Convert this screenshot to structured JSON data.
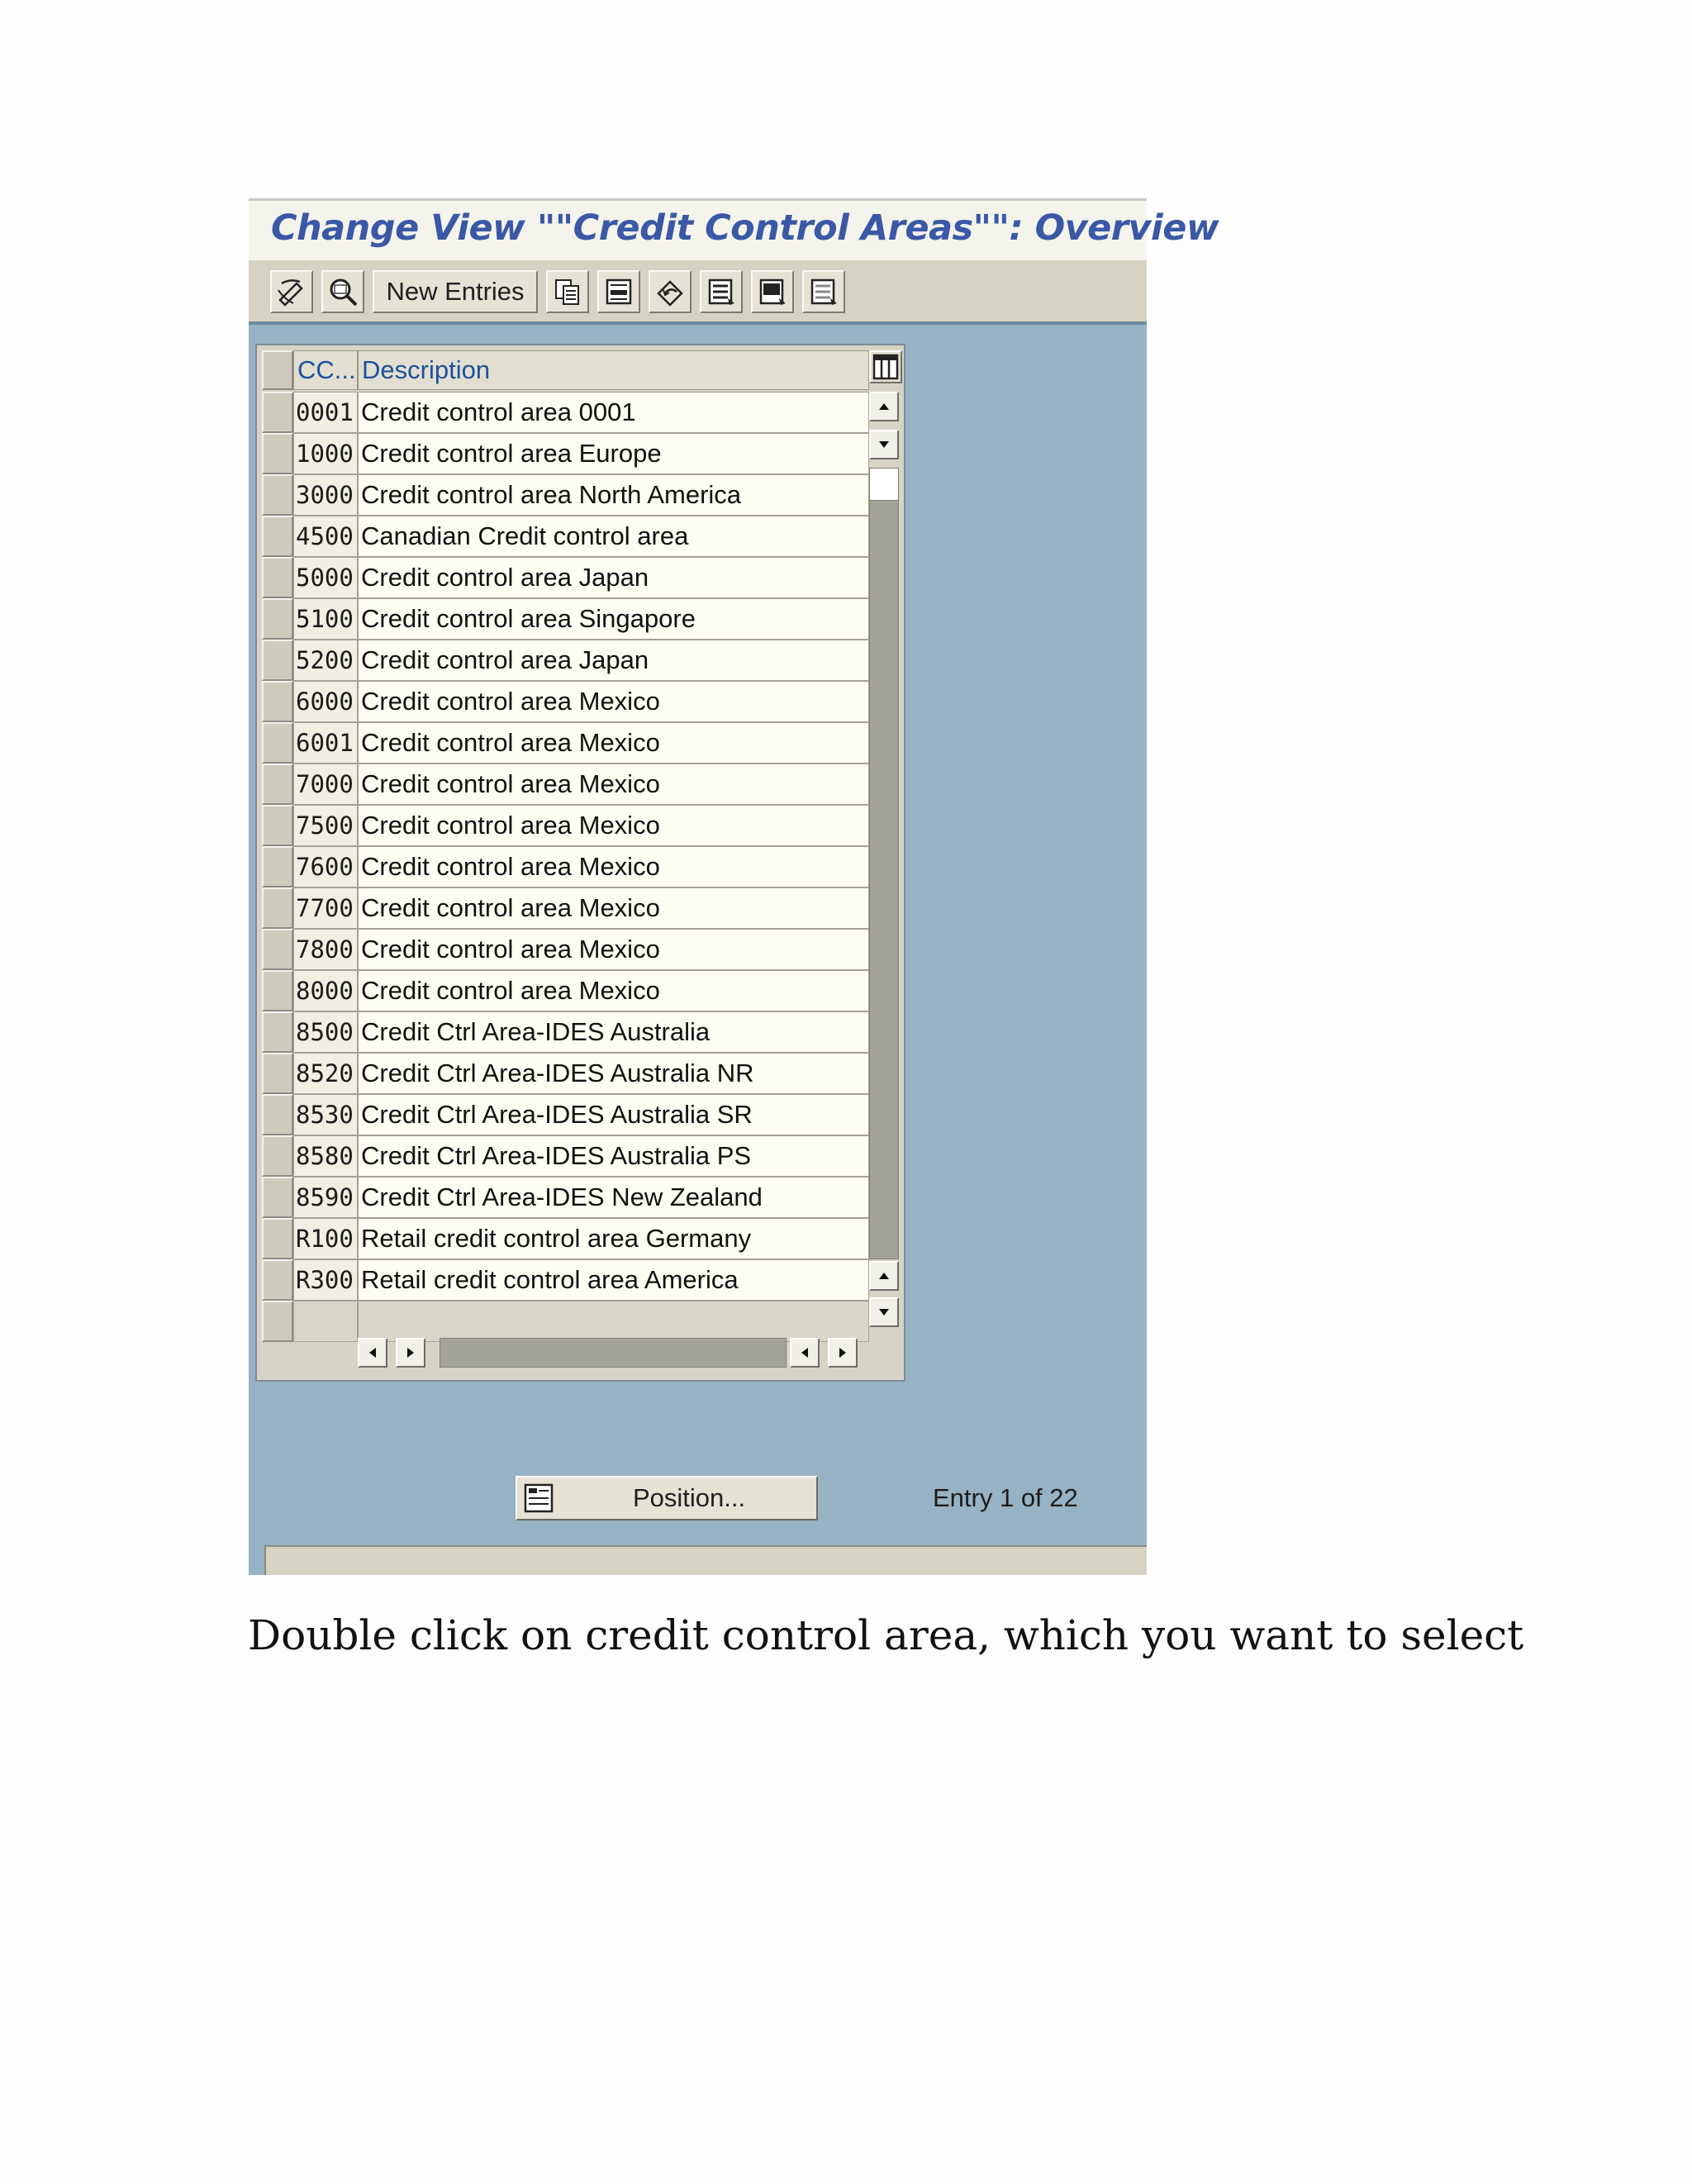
{
  "window": {
    "title": "Change View \"\"Credit Control Areas\"\": Overview"
  },
  "toolbar": {
    "buttons": [
      {
        "icon": "display-change-icon"
      },
      {
        "icon": "find-icon"
      },
      {
        "label": "New Entries"
      },
      {
        "icon": "copy-icon"
      },
      {
        "icon": "delete-icon"
      },
      {
        "icon": "undo-icon"
      },
      {
        "icon": "select-all-icon"
      },
      {
        "icon": "select-block-icon"
      },
      {
        "icon": "deselect-all-icon"
      }
    ]
  },
  "table": {
    "columns": [
      "CC...",
      "Description"
    ],
    "rows": [
      {
        "code": "0001",
        "description": "Credit control area 0001"
      },
      {
        "code": "1000",
        "description": "Credit control area Europe"
      },
      {
        "code": "3000",
        "description": "Credit control area North America"
      },
      {
        "code": "4500",
        "description": "Canadian Credit control area"
      },
      {
        "code": "5000",
        "description": "Credit control area Japan"
      },
      {
        "code": "5100",
        "description": "Credit control area Singapore"
      },
      {
        "code": "5200",
        "description": "Credit control area Japan"
      },
      {
        "code": "6000",
        "description": "Credit control area Mexico"
      },
      {
        "code": "6001",
        "description": "Credit control area Mexico"
      },
      {
        "code": "7000",
        "description": "Credit control area Mexico"
      },
      {
        "code": "7500",
        "description": "Credit control area Mexico"
      },
      {
        "code": "7600",
        "description": "Credit control area Mexico"
      },
      {
        "code": "7700",
        "description": "Credit control area Mexico"
      },
      {
        "code": "7800",
        "description": "Credit control area Mexico"
      },
      {
        "code": "8000",
        "description": "Credit control area Mexico"
      },
      {
        "code": "8500",
        "description": "Credit Ctrl Area-IDES Australia"
      },
      {
        "code": "8520",
        "description": "Credit Ctrl Area-IDES Australia NR"
      },
      {
        "code": "8530",
        "description": "Credit Ctrl Area-IDES Australia SR"
      },
      {
        "code": "8580",
        "description": "Credit Ctrl Area-IDES Australia PS"
      },
      {
        "code": "8590",
        "description": "Credit Ctrl Area-IDES New Zealand"
      },
      {
        "code": "R100",
        "description": "Retail credit control area Germany"
      },
      {
        "code": "R300",
        "description": "Retail credit control area America"
      }
    ]
  },
  "footer": {
    "position_label": "Position...",
    "entry_info": "Entry 1  of 22"
  },
  "caption": "Double click on credit control area, which you want to select",
  "colors": {
    "screen_background": "#97b2c4",
    "title_text": "#3a58a6",
    "header_text": "#1d4f9e",
    "cell_background": "#fefdf2"
  }
}
